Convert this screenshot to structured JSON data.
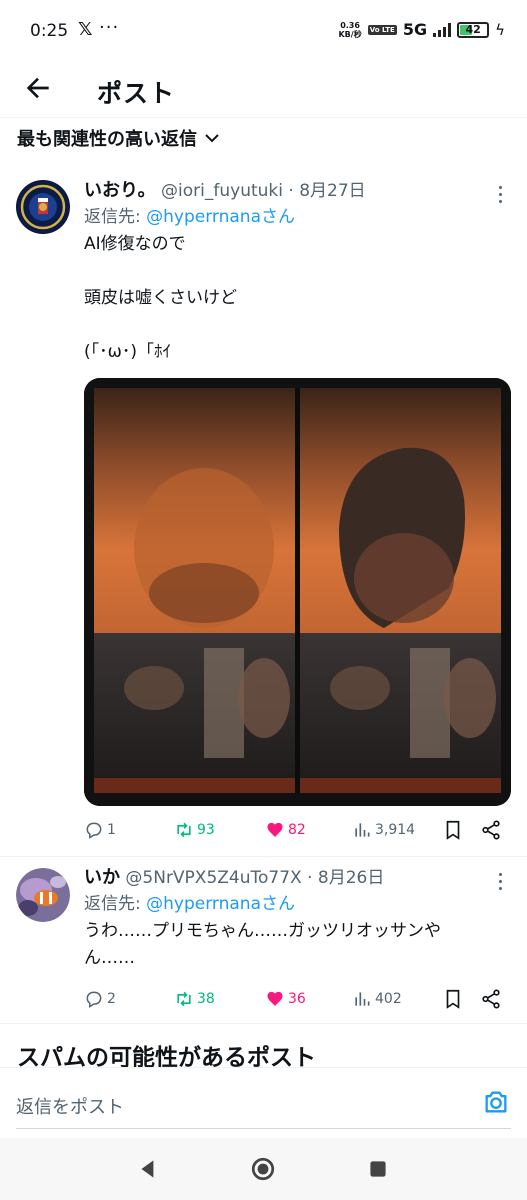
{
  "status_bar": {
    "time": "0:25",
    "x_logo": "𝕏",
    "dots": "···",
    "net_speed_top": "0.36",
    "net_speed_bottom": "KB/秒",
    "volte": "Vo LTE",
    "network": "5G",
    "battery": "42"
  },
  "header": {
    "title": "ポスト",
    "back_icon": "arrow-left-icon"
  },
  "sort": {
    "label": "最も関連性の高い返信",
    "icon": "chevron-down-icon"
  },
  "tweets": [
    {
      "name": "いおり。",
      "handle": "@iori_fuyutuki",
      "dot": "·",
      "date": "8月27日",
      "reply_prefix": "返信先: ",
      "reply_to": "@hyperrnanaさん",
      "lines": [
        "AI修復なので",
        "頭皮は嘘くさいけど",
        "(「･ω･)「ﾎｲ"
      ],
      "stats": {
        "replies": "1",
        "retweets": "93",
        "likes": "82",
        "views": "3,914"
      }
    },
    {
      "name": "いか",
      "handle": "@5NrVPX5Z4uTo77X",
      "dot": "·",
      "date": "8月26日",
      "reply_prefix": "返信先: ",
      "reply_to": "@hyperrnanaさん",
      "lines": [
        "うわ……プリモちゃん……ガッツリオッサンや",
        "ん……"
      ],
      "stats": {
        "replies": "2",
        "retweets": "38",
        "likes": "36",
        "views": "402"
      }
    }
  ],
  "spam_section": {
    "title": "スパムの可能性があるポスト"
  },
  "reply_box": {
    "placeholder": "返信をポスト"
  },
  "colors": {
    "link": "#1d9bf0",
    "retweet": "#00ba7c",
    "like": "#f91880",
    "muted": "#536471"
  }
}
